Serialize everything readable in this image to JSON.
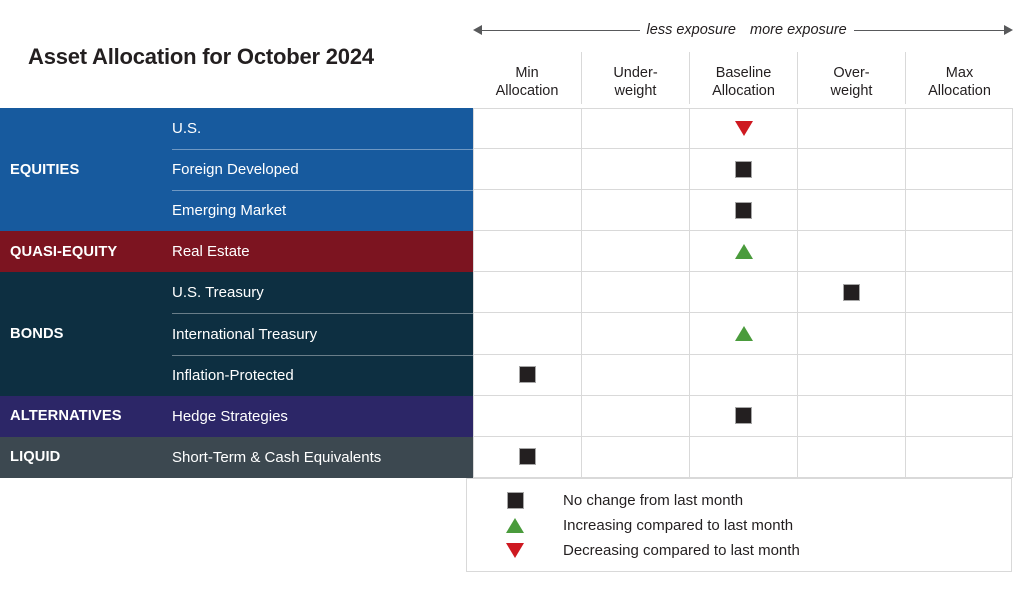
{
  "title": "Asset Allocation for October 2024",
  "exposure": {
    "less_label": "less exposure",
    "more_label": "more exposure",
    "left_arrow_icon": "arrow-left-icon",
    "right_arrow_icon": "arrow-right-icon"
  },
  "columns": [
    {
      "line1": "Min",
      "line2": "Allocation"
    },
    {
      "line1": "Under-",
      "line2": "weight"
    },
    {
      "line1": "Baseline",
      "line2": "Allocation"
    },
    {
      "line1": "Over-",
      "line2": "weight"
    },
    {
      "line1": "Max",
      "line2": "Allocation"
    }
  ],
  "colors": {
    "equities": "#175a9e",
    "quasi_equity": "#7c1420",
    "bonds": "#0d2f41",
    "alternatives": "#2c2667",
    "liquid": "#3c4850",
    "no_change": "#231f20",
    "increasing": "#4a9b3c",
    "decreasing": "#ce1921",
    "grid": "#d9d9d9"
  },
  "categories": [
    {
      "name": "EQUITIES",
      "color_key": "equities",
      "rows": 3
    },
    {
      "name": "QUASI-EQUITY",
      "color_key": "quasi_equity",
      "rows": 1
    },
    {
      "name": "BONDS",
      "color_key": "bonds",
      "rows": 3
    },
    {
      "name": "ALTERNATIVES",
      "color_key": "alternatives",
      "rows": 1
    },
    {
      "name": "LIQUID",
      "color_key": "liquid",
      "rows": 1
    }
  ],
  "rows": [
    {
      "category": "EQUITIES",
      "asset": "U.S.",
      "column": 2,
      "marker": "decreasing",
      "first_of_category": true,
      "last_of_category": false
    },
    {
      "category": "EQUITIES",
      "asset": "Foreign Developed",
      "column": 2,
      "marker": "no_change",
      "first_of_category": false,
      "last_of_category": false
    },
    {
      "category": "EQUITIES",
      "asset": "Emerging Market",
      "column": 2,
      "marker": "no_change",
      "first_of_category": false,
      "last_of_category": true
    },
    {
      "category": "QUASI-EQUITY",
      "asset": "Real Estate",
      "column": 2,
      "marker": "increasing",
      "first_of_category": true,
      "last_of_category": true
    },
    {
      "category": "BONDS",
      "asset": "U.S. Treasury",
      "column": 3,
      "marker": "no_change",
      "first_of_category": true,
      "last_of_category": false
    },
    {
      "category": "BONDS",
      "asset": "International Treasury",
      "column": 2,
      "marker": "increasing",
      "first_of_category": false,
      "last_of_category": false
    },
    {
      "category": "BONDS",
      "asset": "Inflation-Protected",
      "column": 0,
      "marker": "no_change",
      "first_of_category": false,
      "last_of_category": true
    },
    {
      "category": "ALTERNATIVES",
      "asset": "Hedge Strategies",
      "column": 2,
      "marker": "no_change",
      "first_of_category": true,
      "last_of_category": true
    },
    {
      "category": "LIQUID",
      "asset": "Short-Term & Cash Equivalents",
      "column": 0,
      "marker": "no_change",
      "first_of_category": true,
      "last_of_category": true
    }
  ],
  "legend": [
    {
      "marker": "no_change",
      "label": "No change from last month"
    },
    {
      "marker": "increasing",
      "label": "Increasing compared to last month"
    },
    {
      "marker": "decreasing",
      "label": "Decreasing compared to last month"
    }
  ],
  "chart_data": {
    "type": "table",
    "title": "Asset Allocation for October 2024",
    "xlabel": "",
    "ylabel": "",
    "categories": [
      "Min Allocation",
      "Underweight",
      "Baseline Allocation",
      "Overweight",
      "Max Allocation"
    ],
    "annotations": [
      "less exposure",
      "more exposure"
    ],
    "legend_position": "bottom-right",
    "grid": true,
    "series": [
      {
        "name": "U.S.",
        "group": "EQUITIES",
        "values": "Baseline Allocation",
        "change": "decreasing"
      },
      {
        "name": "Foreign Developed",
        "group": "EQUITIES",
        "values": "Baseline Allocation",
        "change": "no change"
      },
      {
        "name": "Emerging Market",
        "group": "EQUITIES",
        "values": "Baseline Allocation",
        "change": "no change"
      },
      {
        "name": "Real Estate",
        "group": "QUASI-EQUITY",
        "values": "Baseline Allocation",
        "change": "increasing"
      },
      {
        "name": "U.S. Treasury",
        "group": "BONDS",
        "values": "Overweight",
        "change": "no change"
      },
      {
        "name": "International Treasury",
        "group": "BONDS",
        "values": "Baseline Allocation",
        "change": "increasing"
      },
      {
        "name": "Inflation-Protected",
        "group": "BONDS",
        "values": "Min Allocation",
        "change": "no change"
      },
      {
        "name": "Hedge Strategies",
        "group": "ALTERNATIVES",
        "values": "Baseline Allocation",
        "change": "no change"
      },
      {
        "name": "Short-Term & Cash Equivalents",
        "group": "LIQUID",
        "values": "Min Allocation",
        "change": "no change"
      }
    ]
  }
}
